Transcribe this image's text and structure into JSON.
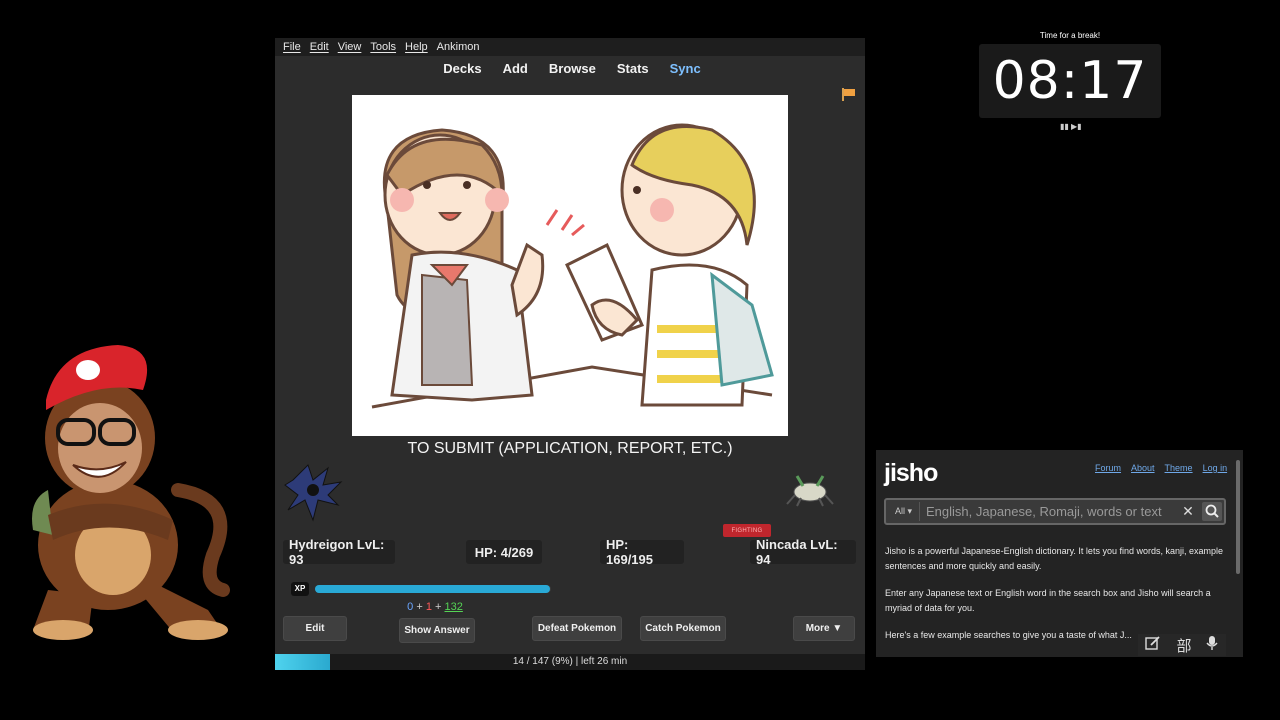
{
  "anki": {
    "menu": [
      "File",
      "Edit",
      "View",
      "Tools",
      "Help",
      "Ankimon"
    ],
    "toolbar": {
      "decks": "Decks",
      "add": "Add",
      "browse": "Browse",
      "stats": "Stats",
      "sync": "Sync"
    },
    "card_text": "TO SUBMIT (APPLICATION, REPORT, ETC.)",
    "battle": {
      "player": "Hydreigon LvL: 93",
      "player_hp": "HP: 4/269",
      "enemy_hp": "HP: 169/195",
      "enemy": "Nincada LvL: 94",
      "enemy_type": "FIGHTING",
      "xp_label": "XP",
      "xp_fraction": 0.997
    },
    "counts": {
      "new": "0",
      "learning": "1",
      "review": "132",
      "plus": "+"
    },
    "buttons": {
      "edit": "Edit",
      "show_answer": "Show Answer",
      "defeat": "Defeat Pokemon",
      "catch": "Catch Pokemon",
      "more": "More ▼"
    },
    "progress": {
      "text": "14 / 147 (9%) | left 26 min",
      "fraction": 0.09
    }
  },
  "timer": {
    "caption": "Time for a break!",
    "time": "08:17",
    "controls": "▮▮ ▶▮"
  },
  "jisho": {
    "logo": "jisho",
    "links": [
      "Forum",
      "About",
      "Theme",
      "Log in"
    ],
    "search_scope": "All ▾",
    "search_placeholder": "English, Japanese, Romaji, words or text",
    "clear": "✕",
    "paragraphs": [
      "Jisho is a powerful Japanese-English dictionary. It lets you find words, kanji, example sentences and more quickly and easily.",
      "Enter any Japanese text or English word in the search box and Jisho will search a myriad of data for you.",
      "Here's a few example searches to give you a taste of what J..."
    ],
    "tool_kanji": "部"
  },
  "colors": {
    "accent_sync": "#7ec0ff",
    "xp_bar": "#29a9d6",
    "fighting_badge": "#c0262d",
    "jisho_green": "#47db27"
  }
}
